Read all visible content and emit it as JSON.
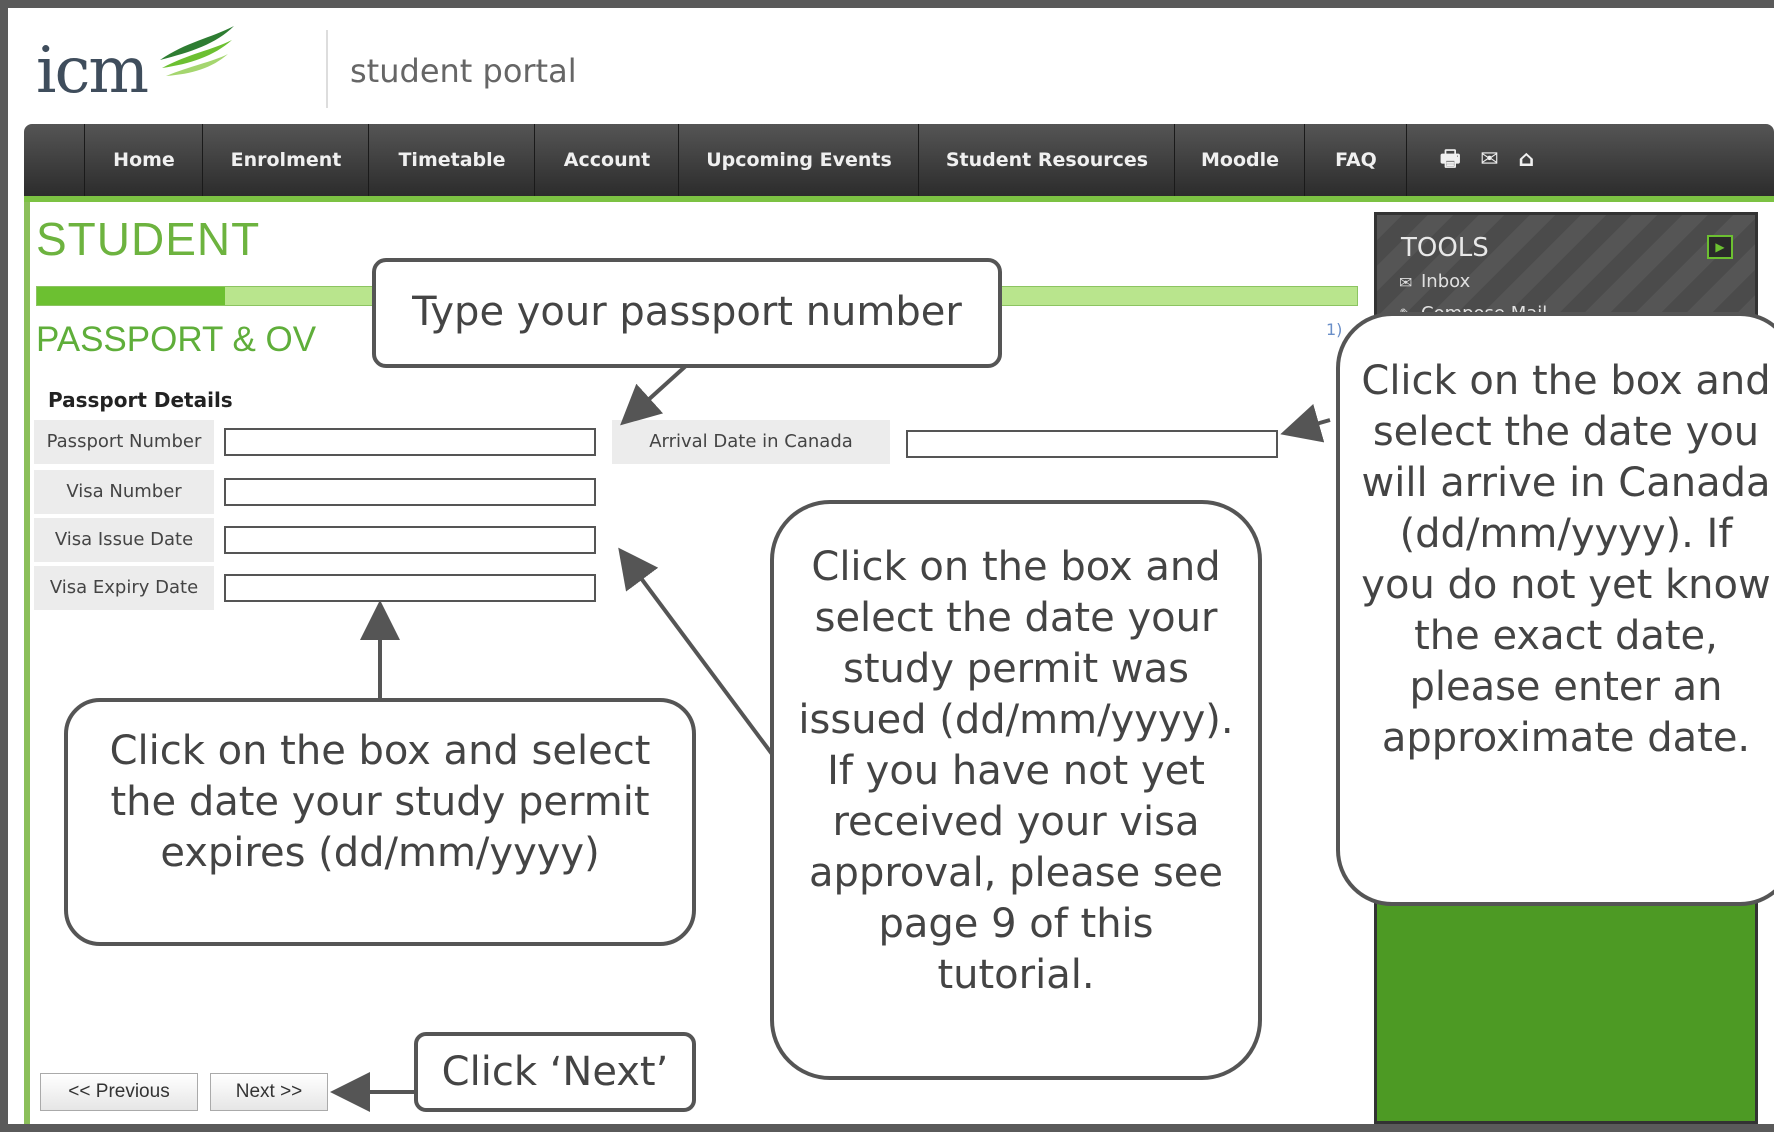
{
  "header": {
    "logo": "icm",
    "portal_title": "student portal"
  },
  "nav": [
    {
      "label": "Home"
    },
    {
      "label": "Enrolment"
    },
    {
      "label": "Timetable"
    },
    {
      "label": "Account"
    },
    {
      "label": "Upcoming Events"
    },
    {
      "label": "Student Resources"
    },
    {
      "label": "Moodle"
    },
    {
      "label": "FAQ"
    }
  ],
  "nav_icons": "🖶 ✉ ⌂",
  "page": {
    "title": "STUDENT",
    "subtitle": "PASSPORT & OV",
    "progress_fraction": 0.14
  },
  "form": {
    "section": "Passport Details",
    "passport_number": {
      "label": "Passport Number",
      "value": ""
    },
    "arrival_date": {
      "label": "Arrival Date in Canada",
      "value": ""
    },
    "visa_number": {
      "label": "Visa Number",
      "value": ""
    },
    "visa_issue_date": {
      "label": "Visa Issue Date",
      "value": ""
    },
    "visa_expiry_date": {
      "label": "Visa Expiry Date",
      "value": ""
    }
  },
  "buttons": {
    "previous": "<< Previous",
    "next": "Next >>"
  },
  "tools": {
    "title": "TOOLS",
    "inbox": "Inbox",
    "compose": "Compose Mail",
    "side_fragment": "1)"
  },
  "callouts": {
    "passport": "Type your passport number",
    "arrival": "Click on the box and select the date you will arrive in Canada (dd/mm/yyyy). If you do not yet know the exact date, please enter an approximate date.",
    "issue": "Click on the box and select the date your study permit was issued (dd/mm/yyyy). If you have not yet received your visa approval, please see page 9 of this tutorial.",
    "expiry": "Click on the box and select the date your study permit expires (dd/mm/yyyy)",
    "next": "Click ‘Next’"
  },
  "colors": {
    "accent_green": "#6cc031",
    "nav_dark": "#2c2c2c",
    "title_green": "#6db33f"
  }
}
